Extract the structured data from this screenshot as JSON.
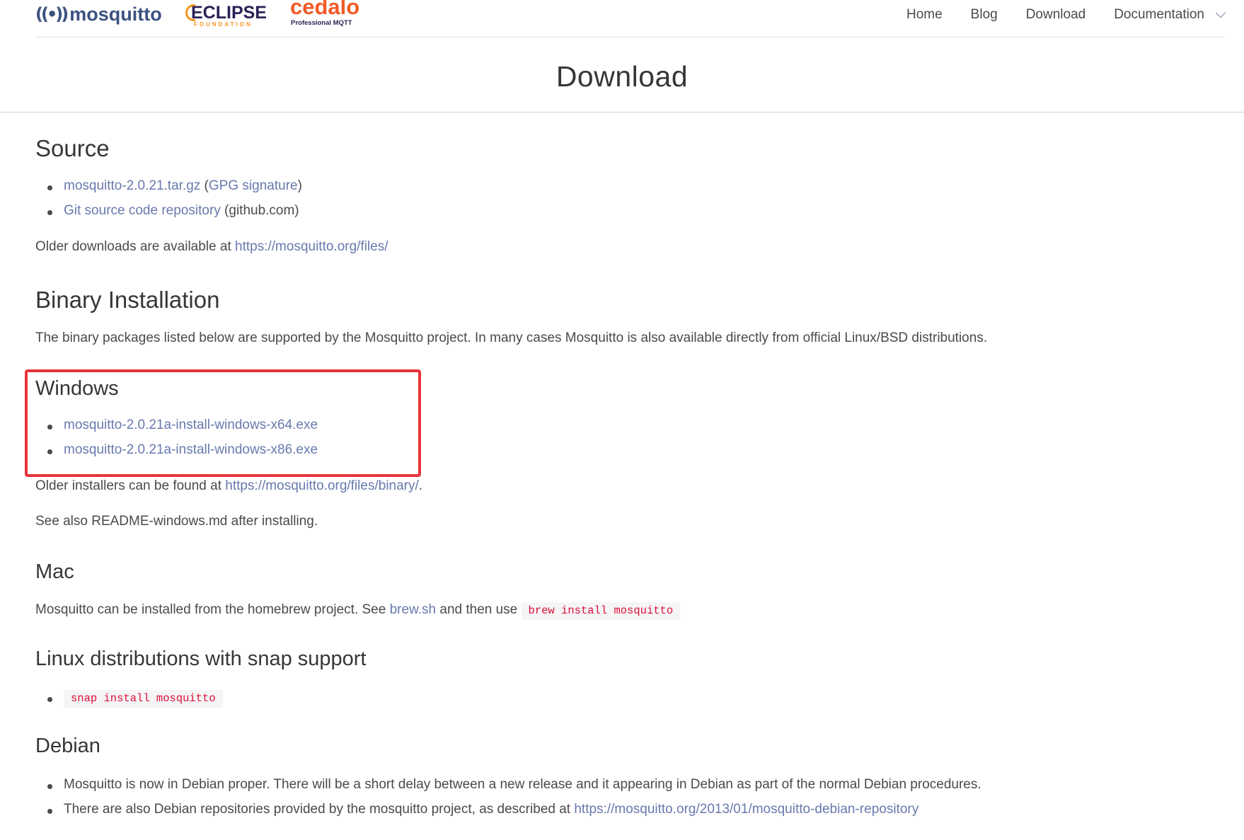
{
  "header": {
    "brand_mosquitto": "mosquitto",
    "brand_eclipse": "ECLIPSE",
    "brand_eclipse_sub": "FOUNDATION",
    "brand_cedalo": "cedalo",
    "brand_cedalo_sub": "Professional MQTT",
    "nav": {
      "home": "Home",
      "blog": "Blog",
      "download": "Download",
      "documentation": "Documentation"
    }
  },
  "page_title": "Download",
  "source": {
    "heading": "Source",
    "tarball_link": "mosquitto-2.0.21.tar.gz",
    "open_paren": " (",
    "gpg_link": "GPG signature",
    "close_paren": ")",
    "git_link": "Git source code repository",
    "git_suffix": " (github.com)",
    "older_text": "Older downloads are available at ",
    "older_link": "https://mosquitto.org/files/"
  },
  "binary": {
    "heading": "Binary Installation",
    "description": "The binary packages listed below are supported by the Mosquitto project. In many cases Mosquitto is also available directly from official Linux/BSD distributions."
  },
  "windows": {
    "heading": "Windows",
    "x64_link": "mosquitto-2.0.21a-install-windows-x64.exe",
    "x86_link": "mosquitto-2.0.21a-install-windows-x86.exe",
    "older_text": "Older installers can be found at ",
    "older_link": "https://mosquitto.org/files/binary/",
    "older_suffix": ".",
    "readme_text": "See also README-windows.md after installing."
  },
  "mac": {
    "heading": "Mac",
    "text_before": "Mosquitto can be installed from the homebrew project. See ",
    "brew_link": "brew.sh",
    "text_middle": " and then use ",
    "command": "brew install mosquitto"
  },
  "snap": {
    "heading": "Linux distributions with snap support",
    "command": "snap install mosquitto"
  },
  "debian": {
    "heading": "Debian",
    "item1": "Mosquitto is now in Debian proper. There will be a short delay between a new release and it appearing in Debian as part of the normal Debian procedures.",
    "item2_text": "There are also Debian repositories provided by the mosquitto project, as described at ",
    "item2_link": "https://mosquitto.org/2013/01/mosquitto-debian-repository"
  },
  "colors": {
    "link": "#6879ad",
    "highlight_box": "#e8343b",
    "code_text": "#da1039",
    "brand_mosquitto": "#3c5280",
    "brand_cedalo": "#f05a28",
    "brand_eclipse_accent": "#f7941e"
  }
}
